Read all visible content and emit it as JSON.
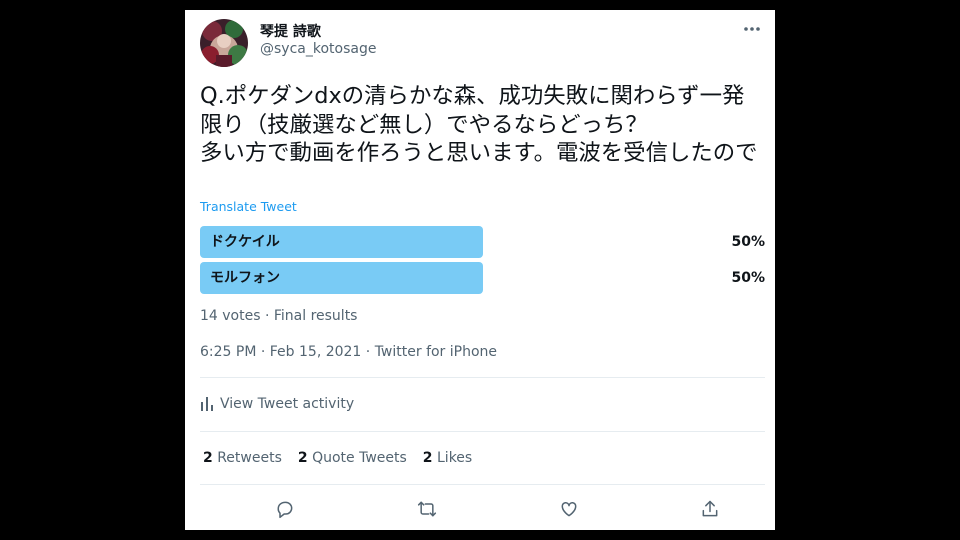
{
  "author": {
    "display_name": "琴提 詩歌",
    "handle": "@syca_kotosage"
  },
  "tweet": {
    "text": "Q.ポケダンdxの清らかな森、成功失敗に関わらず一発限り（技厳選など無し）でやるならどっち？\n多い方で動画を作ろうと思います。電波を受信したので",
    "translate_label": "Translate Tweet"
  },
  "poll": {
    "options": [
      {
        "label": "ドクケイル",
        "percent": "50%",
        "fraction": 0.5
      },
      {
        "label": "モルフォン",
        "percent": "50%",
        "fraction": 0.5
      }
    ],
    "meta": "14 votes · Final results",
    "bar_color": "#79cbf5"
  },
  "timestamp": "6:25 PM · Feb 15, 2021 · Twitter for iPhone",
  "activity_label": "View Tweet activity",
  "stats": {
    "retweets_count": "2",
    "retweets_label": "Retweets",
    "quotes_count": "2",
    "quotes_label": "Quote Tweets",
    "likes_count": "2",
    "likes_label": "Likes"
  },
  "icons": {
    "more": "more-horizontal-icon",
    "activity": "bar-chart-icon",
    "reply": "reply-icon",
    "retweet": "retweet-icon",
    "like": "heart-icon",
    "share": "share-icon"
  },
  "colors": {
    "text": "#0f1419",
    "secondary": "#536471",
    "link": "#1d9bf0"
  }
}
